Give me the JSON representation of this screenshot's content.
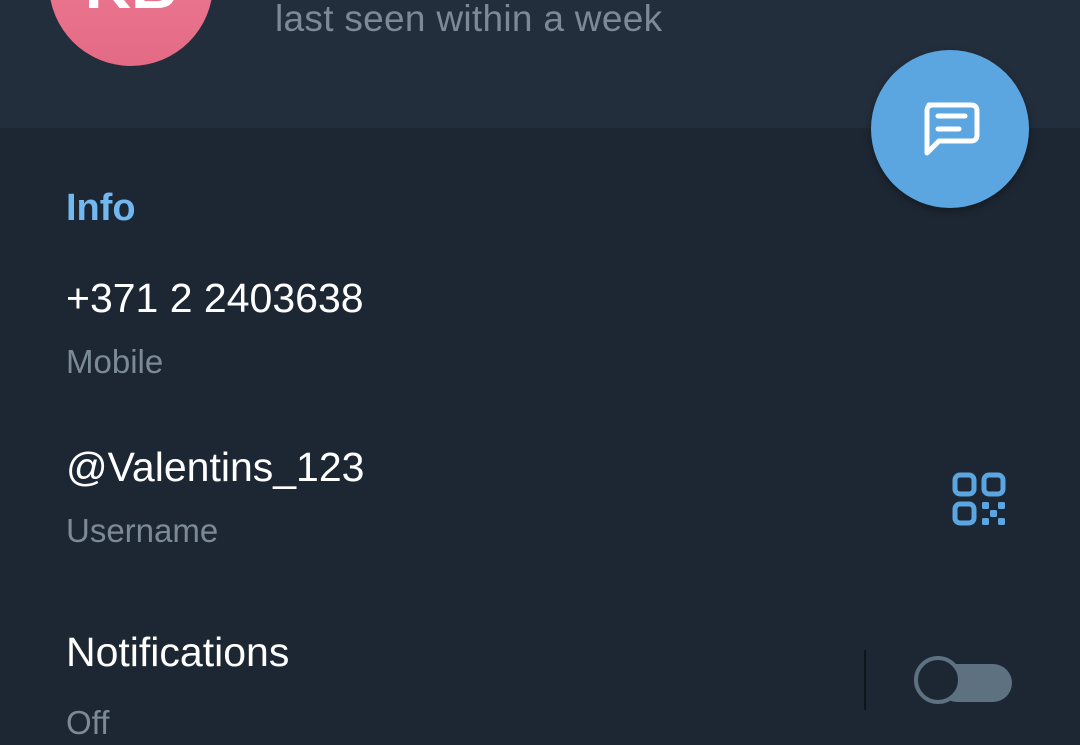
{
  "header": {
    "avatar_initials": "KB",
    "status": "last seen within a week"
  },
  "info": {
    "section_title": "Info",
    "phone": {
      "value": "+371 2 2403638",
      "label": "Mobile"
    },
    "username": {
      "value": "@Valentins_123",
      "label": "Username"
    },
    "notifications": {
      "title": "Notifications",
      "state": "Off",
      "enabled": false
    }
  },
  "icons": {
    "fab": "message-icon",
    "username_action": "qr-code-icon"
  },
  "colors": {
    "background": "#1d2733",
    "header_background": "#232e3c",
    "accent": "#5ba5e0",
    "section_title": "#71b8f0",
    "avatar": "#e46a85",
    "secondary_text": "#7c8a97",
    "toggle_off": "#5d7181"
  }
}
